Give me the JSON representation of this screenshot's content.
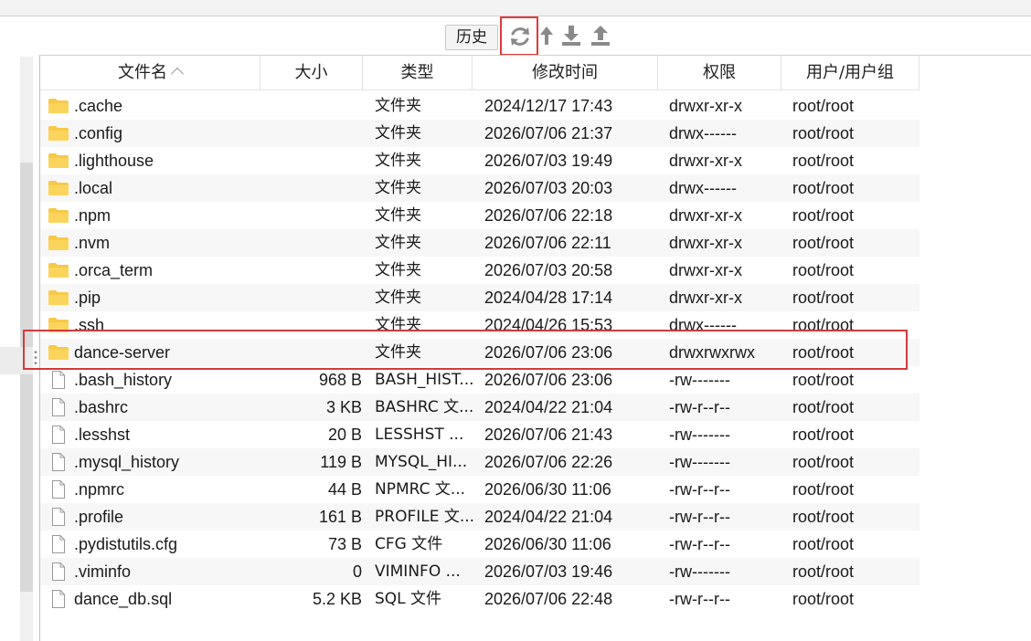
{
  "toolbar": {
    "history_label": "历史",
    "icons": [
      "refresh-icon",
      "up-directory-icon",
      "download-icon",
      "upload-icon"
    ]
  },
  "columns": {
    "name": "文件名",
    "size": "大小",
    "type": "类型",
    "modified": "修改时间",
    "permissions": "权限",
    "owner": "用户/用户组"
  },
  "files": [
    {
      "name": ".cache",
      "size": "",
      "type": "文件夹",
      "modified": "2024/12/17 17:43",
      "perm": "drwxr-xr-x",
      "owner": "root/root",
      "kind": "folder"
    },
    {
      "name": ".config",
      "size": "",
      "type": "文件夹",
      "modified": "2026/07/06 21:37",
      "perm": "drwx------",
      "owner": "root/root",
      "kind": "folder"
    },
    {
      "name": ".lighthouse",
      "size": "",
      "type": "文件夹",
      "modified": "2026/07/03 19:49",
      "perm": "drwxr-xr-x",
      "owner": "root/root",
      "kind": "folder"
    },
    {
      "name": ".local",
      "size": "",
      "type": "文件夹",
      "modified": "2026/07/03 20:03",
      "perm": "drwx------",
      "owner": "root/root",
      "kind": "folder"
    },
    {
      "name": ".npm",
      "size": "",
      "type": "文件夹",
      "modified": "2026/07/06 22:18",
      "perm": "drwxr-xr-x",
      "owner": "root/root",
      "kind": "folder"
    },
    {
      "name": ".nvm",
      "size": "",
      "type": "文件夹",
      "modified": "2026/07/06 22:11",
      "perm": "drwxr-xr-x",
      "owner": "root/root",
      "kind": "folder"
    },
    {
      "name": ".orca_term",
      "size": "",
      "type": "文件夹",
      "modified": "2026/07/03 20:58",
      "perm": "drwxr-xr-x",
      "owner": "root/root",
      "kind": "folder"
    },
    {
      "name": ".pip",
      "size": "",
      "type": "文件夹",
      "modified": "2024/04/28 17:14",
      "perm": "drwxr-xr-x",
      "owner": "root/root",
      "kind": "folder"
    },
    {
      "name": ".ssh",
      "size": "",
      "type": "文件夹",
      "modified": "2024/04/26 15:53",
      "perm": "drwx------",
      "owner": "root/root",
      "kind": "folder"
    },
    {
      "name": "dance-server",
      "size": "",
      "type": "文件夹",
      "modified": "2026/07/06 23:06",
      "perm": "drwxrwxrwx",
      "owner": "root/root",
      "kind": "folder"
    },
    {
      "name": ".bash_history",
      "size": "968 B",
      "type": "BASH_HIST...",
      "modified": "2026/07/06 23:06",
      "perm": "-rw-------",
      "owner": "root/root",
      "kind": "file"
    },
    {
      "name": ".bashrc",
      "size": "3 KB",
      "type": "BASHRC 文...",
      "modified": "2024/04/22 21:04",
      "perm": "-rw-r--r--",
      "owner": "root/root",
      "kind": "file"
    },
    {
      "name": ".lesshst",
      "size": "20 B",
      "type": "LESSHST ...",
      "modified": "2026/07/06 21:43",
      "perm": "-rw-------",
      "owner": "root/root",
      "kind": "file"
    },
    {
      "name": ".mysql_history",
      "size": "119 B",
      "type": "MYSQL_HI...",
      "modified": "2026/07/06 22:26",
      "perm": "-rw-------",
      "owner": "root/root",
      "kind": "file"
    },
    {
      "name": ".npmrc",
      "size": "44 B",
      "type": "NPMRC 文...",
      "modified": "2026/06/30 11:06",
      "perm": "-rw-r--r--",
      "owner": "root/root",
      "kind": "file"
    },
    {
      "name": ".profile",
      "size": "161 B",
      "type": "PROFILE 文...",
      "modified": "2024/04/22 21:04",
      "perm": "-rw-r--r--",
      "owner": "root/root",
      "kind": "file"
    },
    {
      "name": ".pydistutils.cfg",
      "size": "73 B",
      "type": "CFG 文件",
      "modified": "2026/06/30 11:06",
      "perm": "-rw-r--r--",
      "owner": "root/root",
      "kind": "file"
    },
    {
      "name": ".viminfo",
      "size": "0",
      "type": "VIMINFO ...",
      "modified": "2026/07/03 19:46",
      "perm": "-rw-------",
      "owner": "root/root",
      "kind": "file"
    },
    {
      "name": "dance_db.sql",
      "size": "5.2 KB",
      "type": "SQL 文件",
      "modified": "2026/07/06 22:48",
      "perm": "-rw-r--r--",
      "owner": "root/root",
      "kind": "file"
    }
  ],
  "colors": {
    "highlight": "#d33a3a",
    "folder": "#f7c948",
    "toolbar_icon": "#8a8a8a"
  }
}
